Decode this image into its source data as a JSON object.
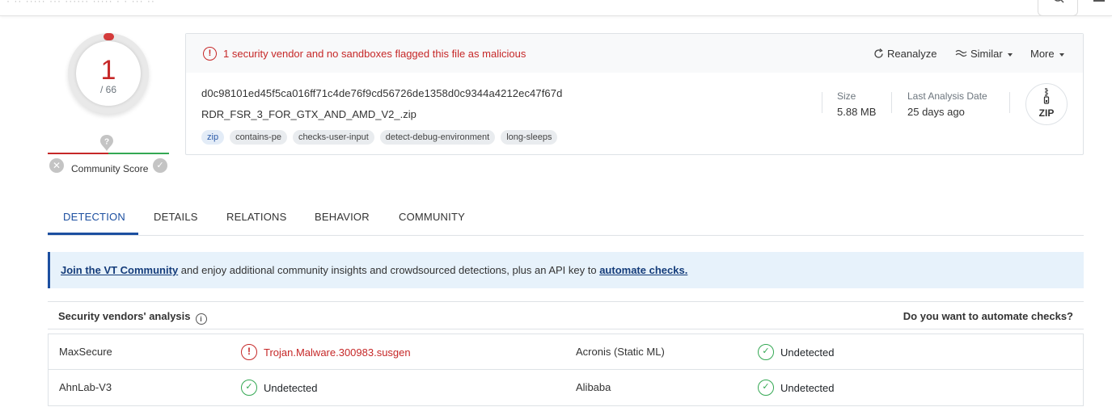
{
  "header": {
    "faint_text": "· ·· ····· ···  ······ ····· · ·  ··· ··",
    "search_icon": "search-icon",
    "menu_icon": "menu-icon"
  },
  "score": {
    "detections": "1",
    "total": "/ 66",
    "community_label": "Community Score",
    "fill_fraction": 0.015
  },
  "summary": {
    "alert": "1 security vendor and no sandboxes flagged this file as malicious",
    "actions": {
      "reanalyze": "Reanalyze",
      "similar": "Similar",
      "more": "More"
    },
    "hash": "d0c98101ed45f5ca016ff71c4de76f9cd56726de1358d0c9344a4212ec47f67d",
    "filename": "RDR_FSR_3_FOR_GTX_AND_AMD_V2_.zip",
    "tags": [
      "zip",
      "contains-pe",
      "checks-user-input",
      "detect-debug-environment",
      "long-sleeps"
    ],
    "size_label": "Size",
    "size_value": "5.88 MB",
    "date_label": "Last Analysis Date",
    "date_value": "25 days ago",
    "file_type": "ZIP"
  },
  "tabs": [
    "DETECTION",
    "DETAILS",
    "RELATIONS",
    "BEHAVIOR",
    "COMMUNITY"
  ],
  "banner": {
    "link1": "Join the VT Community",
    "middle": " and enjoy additional community insights and crowdsourced detections, plus an API key to ",
    "link2": "automate checks."
  },
  "analysis": {
    "title": "Security vendors' analysis",
    "automate_link": "Do you want to automate checks?",
    "rows": [
      {
        "vendor_a": "MaxSecure",
        "result_a": "Trojan.Malware.300983.susgen",
        "status_a": "malicious",
        "vendor_b": "Acronis (Static ML)",
        "result_b": "Undetected",
        "status_b": "undetected"
      },
      {
        "vendor_a": "AhnLab-V3",
        "result_a": "Undetected",
        "status_a": "undetected",
        "vendor_b": "Alibaba",
        "result_b": "Undetected",
        "status_b": "undetected"
      }
    ]
  },
  "colors": {
    "malicious": "#c62828",
    "clean": "#34a853",
    "accent": "#1c4fa0"
  }
}
